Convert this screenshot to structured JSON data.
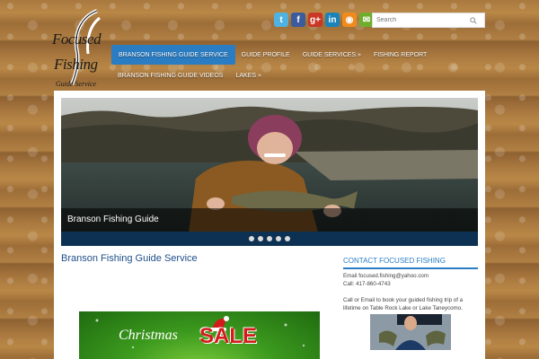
{
  "logo": {
    "line1": "Focused",
    "line2": "Fishing",
    "line3": "Guide Service"
  },
  "social": [
    {
      "name": "twitter-icon",
      "glyph": "t",
      "color": "#4fb2e0"
    },
    {
      "name": "facebook-icon",
      "glyph": "f",
      "color": "#3b5b9c"
    },
    {
      "name": "google-plus-icon",
      "glyph": "g+",
      "color": "#c93826"
    },
    {
      "name": "linkedin-icon",
      "glyph": "in",
      "color": "#1a83b9"
    },
    {
      "name": "rss-icon",
      "glyph": "◉",
      "color": "#f08a1c"
    },
    {
      "name": "email-icon",
      "glyph": "✉",
      "color": "#6fae2d"
    }
  ],
  "search": {
    "placeholder": "Search"
  },
  "nav": {
    "row1": [
      {
        "label": "Branson Fishing Guide Service",
        "active": true
      },
      {
        "label": "Guide Profile"
      },
      {
        "label": "Guide Services »"
      },
      {
        "label": "Fishing Report"
      }
    ],
    "row2": [
      {
        "label": "Branson Fishing Guide Videos"
      },
      {
        "label": "Lakes »"
      }
    ]
  },
  "slider": {
    "caption": "Branson Fishing Guide",
    "dot_count": 5
  },
  "main": {
    "title": "Branson Fishing Guide Service",
    "promo_christmas": "Christmas",
    "promo_sale": "SALE"
  },
  "sidebar": {
    "title": "Contact Focused Fishing",
    "email": "Email focused.fishing@yahoo.com",
    "call": "Call: 417-860-4743",
    "blurb": "Call or Email to book your guided fishing trip of a lifetime on Table Rock Lake or Lake Taneycomo."
  },
  "colors": {
    "accent": "#2a7dc3",
    "title": "#1f4e8a",
    "slider_footer": "#0d3152",
    "wood": "#a9783f"
  }
}
